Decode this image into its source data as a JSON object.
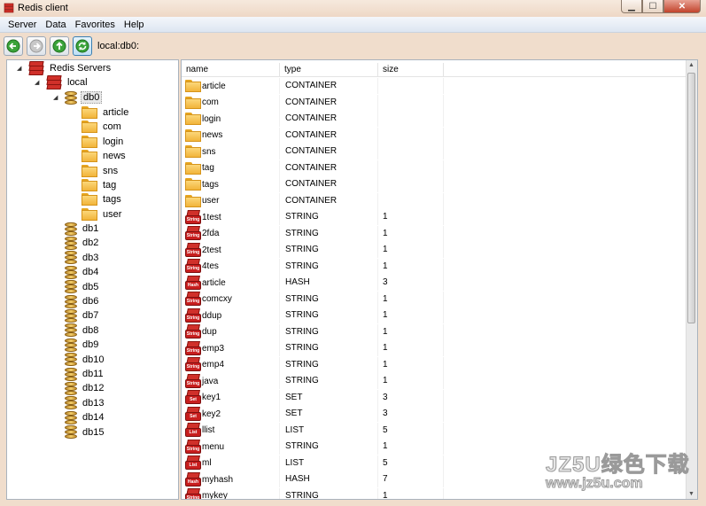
{
  "window": {
    "title": "Redis client"
  },
  "menu": [
    "Server",
    "Data",
    "Favorites",
    "Help"
  ],
  "toolbar": {
    "buttons": [
      {
        "name": "back-button",
        "icon": "arrow-left-icon",
        "color": "#3aa33a"
      },
      {
        "name": "forward-button",
        "icon": "arrow-right-icon",
        "color": "#aaaaaa"
      },
      {
        "name": "up-button",
        "icon": "arrow-up-icon",
        "color": "#3aa33a"
      },
      {
        "name": "refresh-button",
        "icon": "refresh-icon",
        "color": "#3aa33a"
      }
    ],
    "address": "local:db0:"
  },
  "tree": {
    "root": "Redis Servers",
    "server": "local",
    "selected_db": "db0",
    "folders": [
      "article",
      "com",
      "login",
      "news",
      "sns",
      "tag",
      "tags",
      "user"
    ],
    "other_dbs": [
      "db1",
      "db2",
      "db3",
      "db4",
      "db5",
      "db6",
      "db7",
      "db8",
      "db9",
      "db10",
      "db11",
      "db12",
      "db13",
      "db14",
      "db15"
    ]
  },
  "list": {
    "columns": [
      "name",
      "type",
      "size"
    ],
    "rows": [
      {
        "name": "article",
        "type": "CONTAINER",
        "size": "",
        "icon": "folder"
      },
      {
        "name": "com",
        "type": "CONTAINER",
        "size": "",
        "icon": "folder"
      },
      {
        "name": "login",
        "type": "CONTAINER",
        "size": "",
        "icon": "folder"
      },
      {
        "name": "news",
        "type": "CONTAINER",
        "size": "",
        "icon": "folder"
      },
      {
        "name": "sns",
        "type": "CONTAINER",
        "size": "",
        "icon": "folder"
      },
      {
        "name": "tag",
        "type": "CONTAINER",
        "size": "",
        "icon": "folder"
      },
      {
        "name": "tags",
        "type": "CONTAINER",
        "size": "",
        "icon": "folder"
      },
      {
        "name": "user",
        "type": "CONTAINER",
        "size": "",
        "icon": "folder"
      },
      {
        "name": "1test",
        "type": "STRING",
        "size": "1",
        "icon": "String"
      },
      {
        "name": "2fda",
        "type": "STRING",
        "size": "1",
        "icon": "String"
      },
      {
        "name": "2test",
        "type": "STRING",
        "size": "1",
        "icon": "String"
      },
      {
        "name": "4tes",
        "type": "STRING",
        "size": "1",
        "icon": "String"
      },
      {
        "name": "article",
        "type": "HASH",
        "size": "3",
        "icon": "Hash"
      },
      {
        "name": "comcxy",
        "type": "STRING",
        "size": "1",
        "icon": "String"
      },
      {
        "name": "ddup",
        "type": "STRING",
        "size": "1",
        "icon": "String"
      },
      {
        "name": "dup",
        "type": "STRING",
        "size": "1",
        "icon": "String"
      },
      {
        "name": "emp3",
        "type": "STRING",
        "size": "1",
        "icon": "String"
      },
      {
        "name": "emp4",
        "type": "STRING",
        "size": "1",
        "icon": "String"
      },
      {
        "name": "java",
        "type": "STRING",
        "size": "1",
        "icon": "String"
      },
      {
        "name": "key1",
        "type": "SET",
        "size": "3",
        "icon": "Set"
      },
      {
        "name": "key2",
        "type": "SET",
        "size": "3",
        "icon": "Set"
      },
      {
        "name": "llist",
        "type": "LIST",
        "size": "5",
        "icon": "List"
      },
      {
        "name": "menu",
        "type": "STRING",
        "size": "1",
        "icon": "String"
      },
      {
        "name": "ml",
        "type": "LIST",
        "size": "5",
        "icon": "List"
      },
      {
        "name": "myhash",
        "type": "HASH",
        "size": "7",
        "icon": "Hash"
      },
      {
        "name": "mykey",
        "type": "STRING",
        "size": "1",
        "icon": "String"
      }
    ]
  },
  "watermark": {
    "line1": "JZ5U绿色下载",
    "line2": "www.jz5u.com"
  }
}
